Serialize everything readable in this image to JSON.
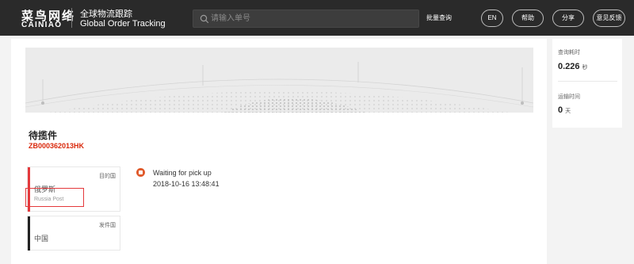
{
  "header": {
    "logo_cn": "菜鸟网络",
    "logo_en": "CAINIAO",
    "subtitle_cn": "全球物流跟踪",
    "subtitle_en": "Global Order Tracking",
    "search_placeholder": "请输入单号",
    "search_icon": "search-icon",
    "bulk_query": "批量查询",
    "buttons": {
      "lang": "EN",
      "help": "帮助",
      "share": "分享",
      "feedback": "意见反馈"
    }
  },
  "order": {
    "status": "待揽件",
    "tracking_number": "ZB000362013HK"
  },
  "destination": {
    "label": "目的国",
    "country": "俄罗斯",
    "carrier": "Russia Post"
  },
  "origin": {
    "label": "发件国",
    "country": "中国"
  },
  "events": [
    {
      "text": "Waiting for pick up",
      "time": "2018-10-16 13:48:41",
      "icon": "package-icon"
    }
  ],
  "stats": {
    "query_time_label": "查询耗时",
    "query_time_value": "0.226",
    "query_time_unit": "秒",
    "transit_label": "运输时间",
    "transit_value": "0",
    "transit_unit": "天"
  },
  "colors": {
    "header_bg": "#2a2a2a",
    "accent_red": "#d9280b",
    "destination_bar": "#e4393c",
    "origin_bar": "#222222"
  }
}
